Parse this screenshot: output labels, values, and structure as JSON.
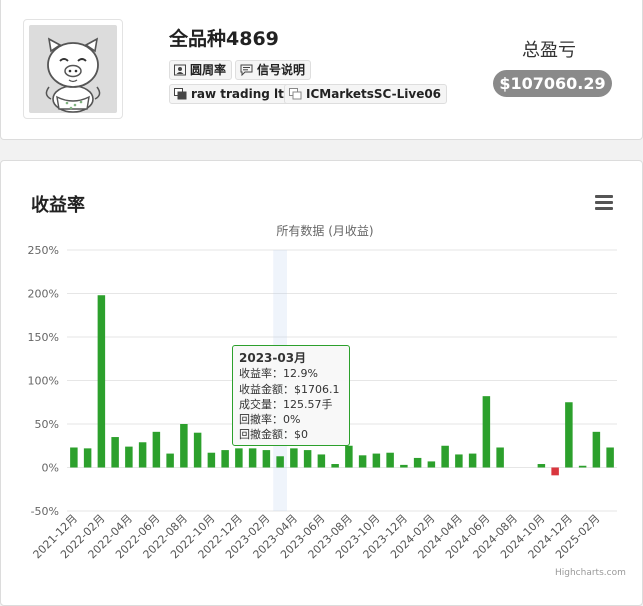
{
  "profile": {
    "name": "全品种4869",
    "tags": [
      {
        "label": "圆周率",
        "icon": "user-card-icon"
      },
      {
        "label": "信号说明",
        "icon": "comment-icon"
      },
      {
        "label": "raw trading ltd",
        "icon": "broker-icon"
      },
      {
        "label": "ICMarketsSC-Live06",
        "icon": "server-icon"
      }
    ],
    "total_pnl_label": "总盈亏",
    "total_pnl_value": "$107060.29"
  },
  "chart_section": {
    "title": "收益率",
    "subtitle": "所有数据 (月收益)",
    "credits": "Highcharts.com"
  },
  "tooltip": {
    "title": "2023-03月",
    "lines": [
      "收益率：12.9%",
      "收益金额：$1706.1",
      "成交量：125.57手",
      "回撤率：0%",
      "回撤金额：$0"
    ]
  },
  "colors": {
    "positive": "#2ca02c",
    "negative": "#d9363e",
    "badge": "#8a8a8a"
  },
  "chart_data": {
    "type": "bar",
    "ylim": [
      -50,
      250
    ],
    "yticks": [
      -50,
      0,
      50,
      100,
      150,
      200,
      250
    ],
    "ytick_labels": [
      "-50%",
      "0%",
      "50%",
      "100%",
      "150%",
      "200%",
      "250%"
    ],
    "x_tick_labels": [
      "2021-12月",
      "2022-02月",
      "2022-04月",
      "2022-06月",
      "2022-08月",
      "2022-10月",
      "2022-12月",
      "2023-02月",
      "2023-04月",
      "2023-06月",
      "2023-08月",
      "2023-10月",
      "2023-12月",
      "2024-02月",
      "2024-04月",
      "2024-06月",
      "2024-08月",
      "2024-10月",
      "2024-12月",
      "2025-02月"
    ],
    "categories": [
      "2021-12",
      "2022-01",
      "2022-02",
      "2022-03",
      "2022-04",
      "2022-05",
      "2022-06",
      "2022-07",
      "2022-08",
      "2022-09",
      "2022-10",
      "2022-11",
      "2022-12",
      "2023-01",
      "2023-02",
      "2023-03",
      "2023-04",
      "2023-05",
      "2023-06",
      "2023-07",
      "2023-08",
      "2023-09",
      "2023-10",
      "2023-11",
      "2023-12",
      "2024-01",
      "2024-02",
      "2024-03",
      "2024-04",
      "2024-05",
      "2024-06",
      "2024-07",
      "2024-08",
      "2024-09",
      "2024-10",
      "2024-11",
      "2024-12",
      "2025-01",
      "2025-02",
      "2025-03"
    ],
    "values": [
      23,
      22,
      198,
      35,
      24,
      29,
      41,
      16,
      50,
      40,
      17,
      20,
      22,
      22,
      20,
      12.9,
      22,
      20,
      15,
      4,
      25,
      14,
      16,
      17,
      3,
      11,
      7,
      25,
      15,
      16,
      82,
      23,
      0,
      0,
      4,
      -9,
      75,
      2,
      41,
      23
    ],
    "highlighted_category": "2023-03",
    "grid": true
  }
}
